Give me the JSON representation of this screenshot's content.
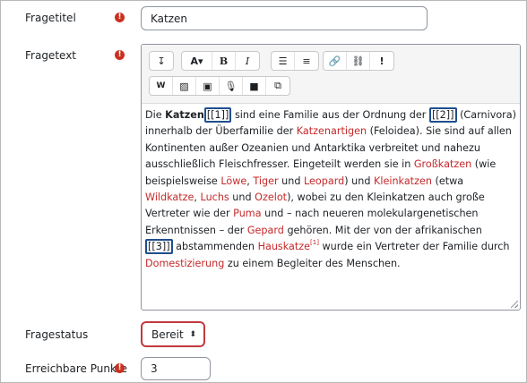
{
  "fields": {
    "title_label": "Fragetitel",
    "title_value": "Katzen",
    "text_label": "Fragetext",
    "status_label": "Fragestatus",
    "status_value": "Bereit",
    "points_label": "Erreichbare Punkte",
    "points_value": "3"
  },
  "toolbar": {
    "row1": [
      {
        "icon": "collapse-icon",
        "glyph": "↧"
      },
      {
        "icon": "font-icon",
        "glyph": "A▾"
      },
      {
        "icon": "bold-icon",
        "glyph": "B"
      },
      {
        "icon": "italic-icon",
        "glyph": "I"
      },
      {
        "icon": "unordered-list-icon",
        "glyph": "☰"
      },
      {
        "icon": "ordered-list-icon",
        "glyph": "≡"
      },
      {
        "icon": "link-icon",
        "glyph": "🔗"
      },
      {
        "icon": "unlink-icon",
        "glyph": "⛓"
      },
      {
        "icon": "exclamation-icon",
        "glyph": "!"
      }
    ],
    "row2": [
      {
        "icon": "wiris-icon",
        "glyph": "W"
      },
      {
        "icon": "image-icon",
        "glyph": "▨"
      },
      {
        "icon": "media-icon",
        "glyph": "▣"
      },
      {
        "icon": "microphone-icon",
        "glyph": "🎙"
      },
      {
        "icon": "video-icon",
        "glyph": "■"
      },
      {
        "icon": "copy-icon",
        "glyph": "⧉"
      }
    ]
  },
  "content": {
    "p1": "Die ",
    "p2": "Katzen",
    "m1": "[[1]]",
    "p3": " sind eine Familie aus der Ordnung der ",
    "m2": "[[2]]",
    "p4": " (Carnivora) innerhalb der Überfamilie der ",
    "l1": "Katzenartigen",
    "p5": " (Feloidea). Sie sind auf allen Kontinenten außer Ozeanien und Antarktika verbreitet und nahezu ausschließlich Fleischfresser. Eingeteilt werden sie in ",
    "l2": "Großkatzen",
    "p6": " (wie beispielsweise ",
    "l3": "Löwe",
    "p7": ", ",
    "l4": "Tiger",
    "p8": " und ",
    "l5": "Leopard",
    "p9": ") und ",
    "l6": "Kleinkatzen",
    "p10": " (etwa ",
    "l7": "Wildkatze",
    "p11": ", ",
    "l8": "Luchs",
    "p12": " und ",
    "l9": "Ozelot",
    "p13": "), wobei zu den Kleinkatzen auch große Vertreter wie der ",
    "l10": "Puma",
    "p14": " und – nach neueren molekulargenetischen Erkenntnissen – der ",
    "l11": "Gepard",
    "p15": " gehören. Mit der von der afrikanischen ",
    "m3": "[[3]]",
    "p16": " abstammenden ",
    "l12": "Hauskatze",
    "sup": "[1]",
    "p17": " wurde ein Vertreter der Familie durch ",
    "l13": "Domestizierung",
    "p18": " zu einem Begleiter des Menschen."
  }
}
